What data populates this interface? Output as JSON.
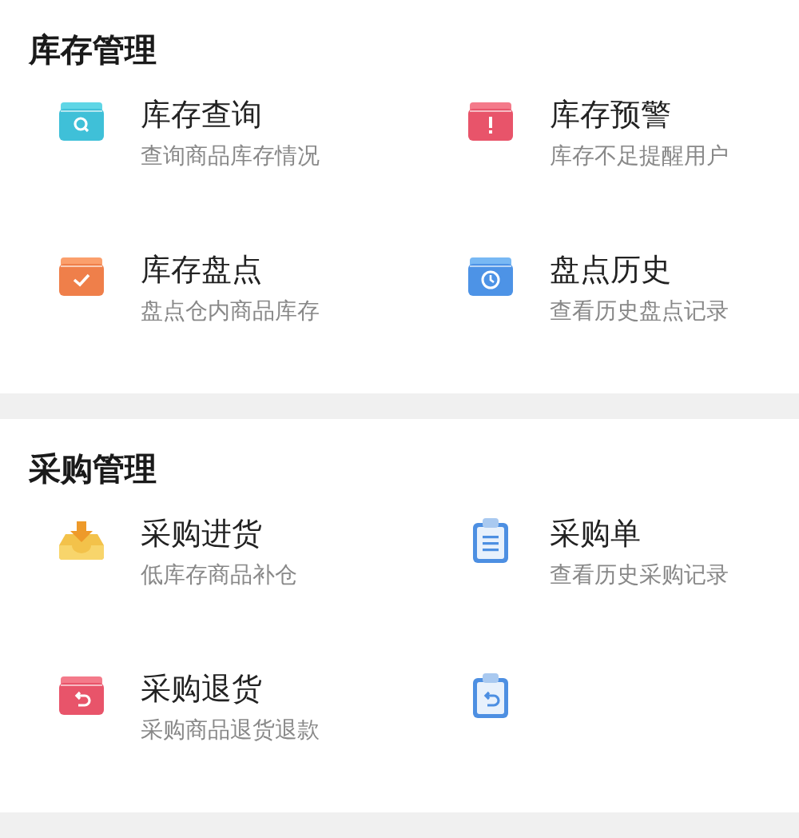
{
  "sections": [
    {
      "title": "库存管理",
      "items": [
        {
          "kind": "search-box",
          "title": "库存查询",
          "subtitle": "查询商品库存情况"
        },
        {
          "kind": "alert-box",
          "title": "库存预警",
          "subtitle": "库存不足提醒用户"
        },
        {
          "kind": "check-box",
          "title": "库存盘点",
          "subtitle": "盘点仓内商品库存"
        },
        {
          "kind": "clock-box",
          "title": "盘点历史",
          "subtitle": "查看历史盘点记录"
        }
      ]
    },
    {
      "title": "采购管理",
      "items": [
        {
          "kind": "inbox",
          "title": "采购进货",
          "subtitle": "低库存商品补仓"
        },
        {
          "kind": "clipboard",
          "title": "采购单",
          "subtitle": "查看历史采购记录"
        },
        {
          "kind": "return-box",
          "title": "采购退货",
          "subtitle": "采购商品退货退款"
        },
        {
          "kind": "return-clipboard"
        }
      ]
    }
  ]
}
